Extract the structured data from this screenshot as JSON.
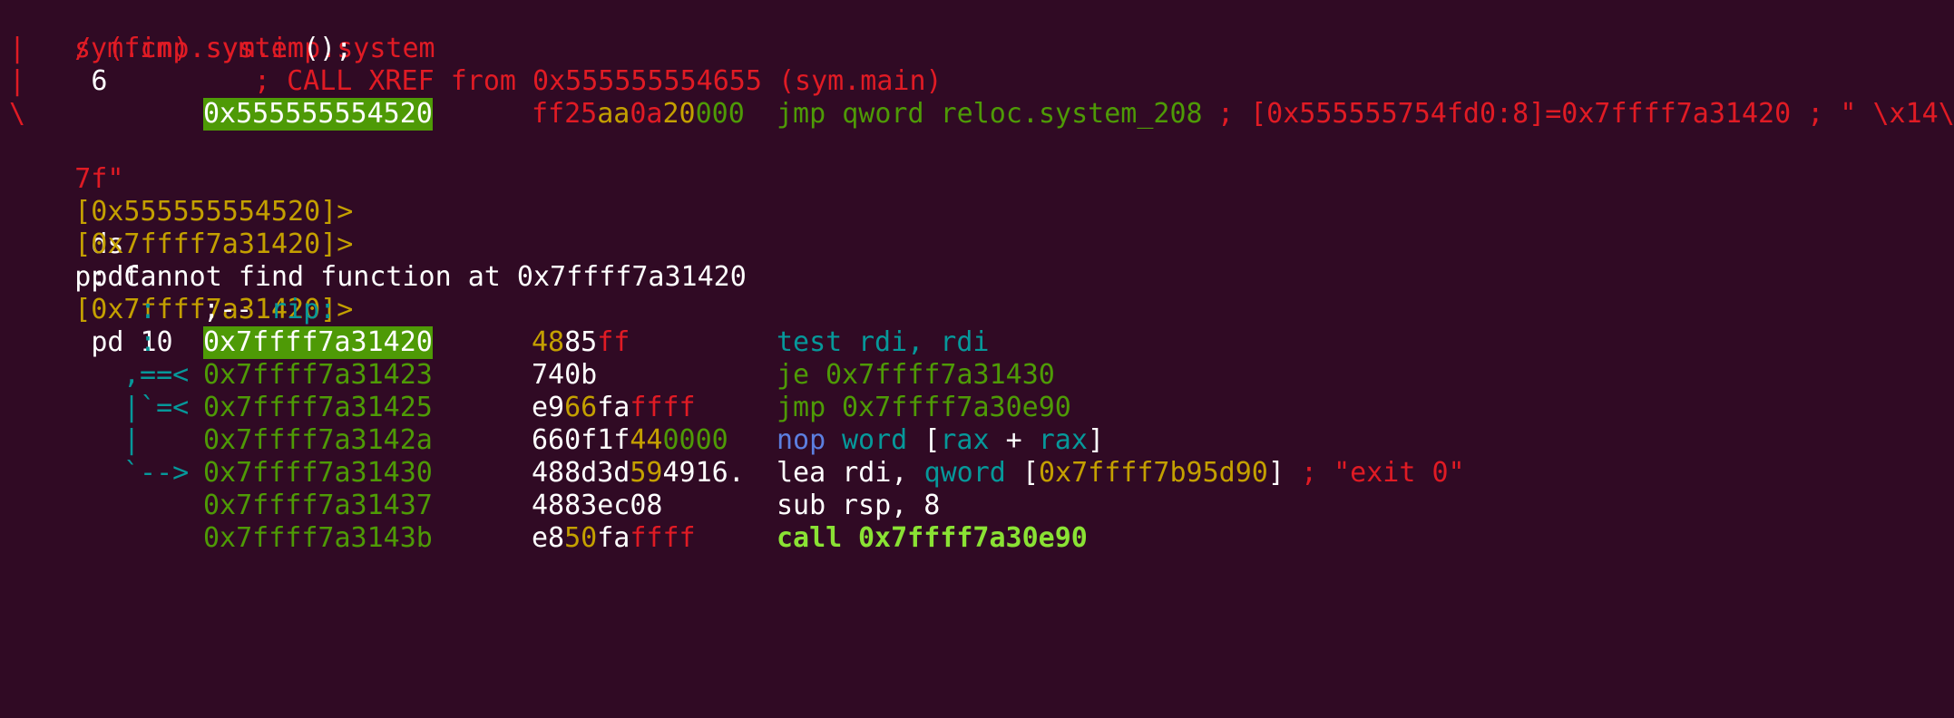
{
  "lines": {
    "l0": {
      "a": "/ (fcn) sym.imp.system",
      "b": "6"
    },
    "l1": {
      "bar": "|",
      "a": "sym.imp.system",
      "b": "();"
    },
    "l2": {
      "bar": "|",
      "a": "; CALL XREF from 0x555555554655 (sym.main)"
    },
    "l3": {
      "bar": "\\",
      "addr": "0x555555554520",
      "bytes": [
        {
          "t": "ff25"
        },
        {
          "t": "aa"
        },
        {
          "t": "0a"
        },
        {
          "t": "20"
        },
        {
          "t": "00"
        },
        {
          "t": "0"
        }
      ],
      "op": "jmp qword reloc.system_208",
      "comment": "; [0x555555754fd0:8]=0x7ffff7a31420 ; \" \\x14\\"
    },
    "l4": {
      "a": "7f\""
    },
    "l5": {
      "prompt": "[0x555555554520]>",
      "cmd": "ds"
    },
    "l6": {
      "prompt": "[0x7ffff7a31420]>",
      "cmd": "pdf"
    },
    "l7": {
      "a": "p: Cannot find function at 0x7ffff7a31420"
    },
    "l8": {
      "prompt": "[0x7ffff7a31420]>",
      "cmd": "pd 10"
    },
    "l9": {
      "arrow": ":",
      "a": ";--",
      "b": "rip:"
    },
    "l10": {
      "arrow": ":",
      "addr": "0x7ffff7a31420",
      "bytes": [
        "48",
        "85",
        "ff"
      ],
      "mn": "test",
      "ops": "rdi, rdi"
    },
    "l11": {
      "arrow": ",==<",
      "addr": "0x7ffff7a31423",
      "bytes": [
        "74",
        "0b"
      ],
      "mn": "je",
      "ops": "0x7ffff7a31430"
    },
    "l12": {
      "arrow": "|`=<",
      "addr": "0x7ffff7a31425",
      "bytes": [
        "e9",
        "66",
        "fa",
        "ffff"
      ],
      "mn": "jmp",
      "ops": "0x7ffff7a30e90"
    },
    "l13": {
      "arrow": "|",
      "addr": "0x7ffff7a3142a",
      "bytes": [
        "66",
        "0f1f",
        "44",
        "0000"
      ],
      "mn": "nop",
      "w": "word",
      "lb": "[",
      "r1": "rax",
      "plus": "+",
      "r2": "rax",
      "rb": "]"
    },
    "l14": {
      "arrow": "`-->",
      "addr": "0x7ffff7a31430",
      "bytes": [
        "48",
        "8d",
        "3d",
        "59",
        "49",
        "16",
        "."
      ],
      "mn": "lea",
      "r": "rdi,",
      "w": "qword",
      "lb": "[",
      "mem": "0x7ffff7b95d90",
      "rb": "]",
      "comment": "; \"exit 0\""
    },
    "l15": {
      "addr": "0x7ffff7a31437",
      "bytes": [
        "48",
        "83",
        "ec",
        "08"
      ],
      "mn": "sub",
      "ops": "rsp, 8"
    },
    "l16": {
      "addr": "0x7ffff7a3143b",
      "bytes": [
        "e8",
        "50",
        "fa",
        "ffff"
      ],
      "mn": "call",
      "ops": "0x7ffff7a30e90"
    }
  },
  "colors": {
    "background": "#300a24",
    "red": "#e01b24",
    "yellow": "#c4a000",
    "green": "#4e9a06",
    "bright_green": "#8ae234",
    "cyan": "#06989a",
    "blue": "#5c7fe0"
  }
}
